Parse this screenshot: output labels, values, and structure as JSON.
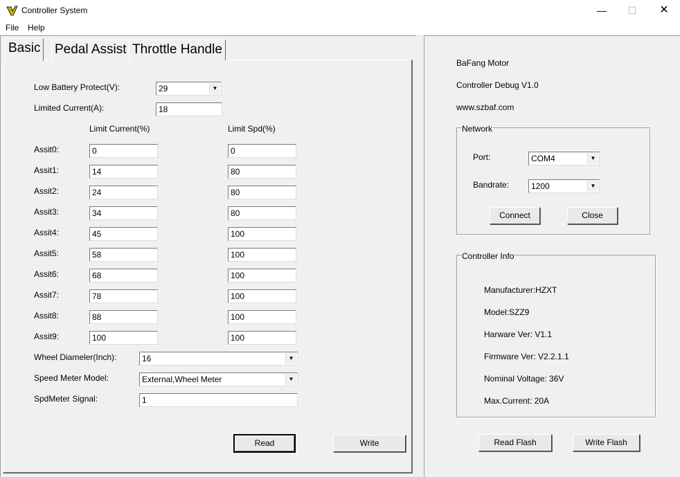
{
  "window": {
    "title": "Controller System"
  },
  "menu": {
    "file": "File",
    "help": "Help"
  },
  "tabs": [
    "Basic",
    "Pedal Assist",
    "Throttle Handle"
  ],
  "basic": {
    "low_battery_label": "Low Battery Protect(V):",
    "low_battery_value": "29",
    "limited_current_label": "Limited Current(A):",
    "limited_current_value": "18",
    "col_current": "Limit Current(%)",
    "col_speed": "Limit Spd(%)",
    "assist": [
      {
        "label": "Assit0:",
        "current": "0",
        "speed": "0"
      },
      {
        "label": "Assit1:",
        "current": "14",
        "speed": "80"
      },
      {
        "label": "Assit2:",
        "current": "24",
        "speed": "80"
      },
      {
        "label": "Assit3:",
        "current": "34",
        "speed": "80"
      },
      {
        "label": "Assit4:",
        "current": "45",
        "speed": "100"
      },
      {
        "label": "Assit5:",
        "current": "58",
        "speed": "100"
      },
      {
        "label": "Assit6:",
        "current": "68",
        "speed": "100"
      },
      {
        "label": "Assit7:",
        "current": "78",
        "speed": "100"
      },
      {
        "label": "Assit8:",
        "current": "88",
        "speed": "100"
      },
      {
        "label": "Assit9:",
        "current": "100",
        "speed": "100"
      }
    ],
    "wheel_label": "Wheel Diameler(Inch):",
    "wheel_value": "16",
    "speed_meter_label": "Speed Meter Model:",
    "speed_meter_value": "External,Wheel Meter",
    "spd_signal_label": "SpdMeter Signal:",
    "spd_signal_value": "1",
    "read": "Read",
    "write": "Write"
  },
  "info": {
    "brand": "BaFang Motor",
    "debug": "Controller Debug V1.0",
    "site": "www.szbaf.com",
    "network_title": "Network",
    "port_label": "Port:",
    "port_value": "COM4",
    "baud_label": "Bandrate:",
    "baud_value": "1200",
    "connect": "Connect",
    "close": "Close",
    "controller_title": "Controller Info",
    "manufacturer": "Manufacturer:HZXT",
    "model": "Model:SZZ9",
    "hardware": "Harware Ver: V1.1",
    "firmware": "Firmware Ver: V2.2.1.1",
    "voltage": "Nominal Voltage: 36V",
    "current": "Max.Current: 20A",
    "read_flash": "Read Flash",
    "write_flash": "Write Flash"
  }
}
